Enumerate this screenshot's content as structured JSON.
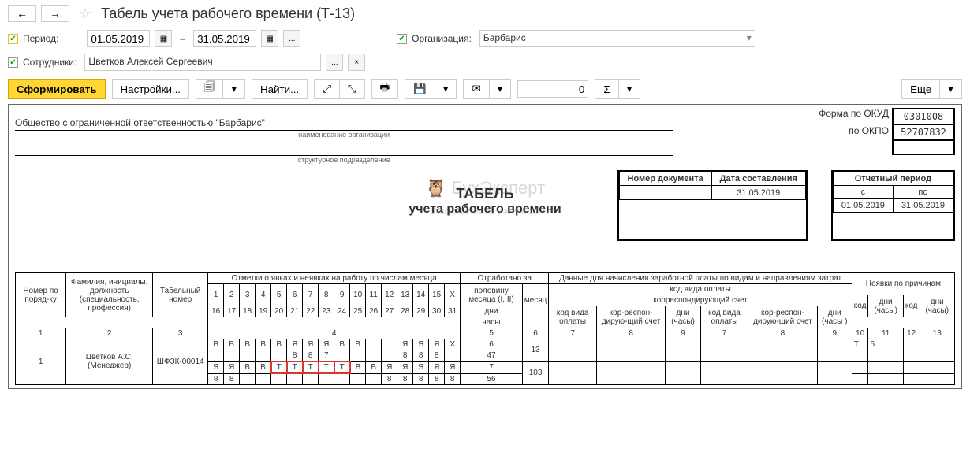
{
  "header": {
    "title": "Табель учета рабочего времени (Т-13)"
  },
  "filters": {
    "period_label": "Период:",
    "date_from": "01.05.2019",
    "date_to": "31.05.2019",
    "dash": "–",
    "org_label": "Организация:",
    "org_value": "Барбарис",
    "emp_label": "Сотрудники:",
    "emp_value": "Цветков Алексей Сергеевич"
  },
  "toolbar": {
    "generate": "Сформировать",
    "settings": "Настройки...",
    "find": "Найти...",
    "sum_input": "0",
    "more": "Еще"
  },
  "report": {
    "okud_label": "Форма по ОКУД",
    "okud_value": "0301008",
    "okpo_label": "по ОКПО",
    "okpo_value": "52707832",
    "org_full": "Общество с ограниченной ответственностью \"Барбарис\"",
    "org_sub": "наименование организации",
    "struct_sub": "структурное подразделение",
    "doc_num_label": "Номер документа",
    "doc_date_label": "Дата составления",
    "doc_num": "",
    "doc_date": "31.05.2019",
    "period_label": "Отчетный период",
    "period_from_label": "с",
    "period_to_label": "по",
    "period_from": "01.05.2019",
    "period_to": "31.05.2019",
    "title_main": "ТАБЕЛЬ",
    "title_sub": "учета  рабочего времени"
  },
  "table": {
    "hdr_num": "Номер по поряд-ку",
    "hdr_fio": "Фамилия, инициалы, должность (специальность, профессия)",
    "hdr_tab": "Табельный номер",
    "hdr_marks": "Отметки о явках и неявках на работу по числам месяца",
    "hdr_worked": "Отработано за",
    "hdr_payroll": "Данные для начисления заработной платы по видам и направлениям затрат",
    "hdr_absence": "Неявки по причинам",
    "hdr_half": "половину месяца (I, II)",
    "hdr_month": "месяц",
    "hdr_pay_code": "код вида оплаты",
    "hdr_corr": "корреспондирующий счет",
    "hdr_days": "дни",
    "hdr_hours": "часы",
    "hdr_code": "код",
    "hdr_days_hours": "дни (часы)",
    "hdr_days_hours2": "дни (часы )",
    "hdr_kod_vida": "код вида оплаты",
    "hdr_korr": "кор-респон-дирую-щий счет",
    "days1": [
      "1",
      "2",
      "3",
      "4",
      "5",
      "6",
      "7",
      "8",
      "9",
      "10",
      "11",
      "12",
      "13",
      "14",
      "15",
      "X"
    ],
    "days2": [
      "16",
      "17",
      "18",
      "19",
      "20",
      "21",
      "22",
      "23",
      "24",
      "25",
      "26",
      "27",
      "28",
      "29",
      "30",
      "31"
    ],
    "col_nums": [
      "1",
      "2",
      "3",
      "4",
      "5",
      "6",
      "7",
      "8",
      "9",
      "7",
      "8",
      "9",
      "10",
      "11",
      "12",
      "13"
    ],
    "row": {
      "num": "1",
      "fio": "Цветков А.С. (Менеджер)",
      "tabnum": "ШФЗК-00014",
      "marks1": [
        "В",
        "В",
        "В",
        "В",
        "В",
        "Я",
        "Я",
        "Я",
        "В",
        "В",
        "",
        "",
        "Я",
        "Я",
        "Я",
        "Х"
      ],
      "hours1": [
        "",
        "",
        "",
        "",
        "",
        "8",
        "8",
        "7",
        "",
        "",
        "",
        "",
        "8",
        "8",
        "8",
        ""
      ],
      "marks2": [
        "Я",
        "Я",
        "В",
        "В",
        "Т",
        "Т",
        "Т",
        "Т",
        "Т",
        "В",
        "В",
        "Я",
        "Я",
        "Я",
        "Я",
        "Я"
      ],
      "hours2": [
        "8",
        "8",
        "",
        "",
        "",
        "",
        "",
        "",
        "",
        "",
        "",
        "8",
        "8",
        "8",
        "8",
        "8"
      ],
      "half1_days": "6",
      "half1_hours": "47",
      "half2_days": "7",
      "half2_hours": "56",
      "month_days": "13",
      "month_hours": "103",
      "abs_code": "Т",
      "abs_days": "5"
    }
  }
}
